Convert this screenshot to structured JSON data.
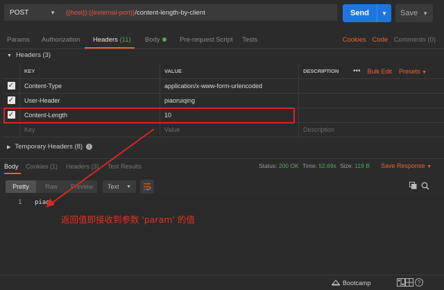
{
  "request": {
    "method": "POST",
    "url_var1": "{{host}}",
    "url_sep": ":",
    "url_var2": "{{external-port}}",
    "url_path": "/content-length-by-client",
    "send_label": "Send",
    "save_label": "Save"
  },
  "tabs": {
    "params": "Params",
    "authorization": "Authorization",
    "headers": "Headers",
    "headers_count": "(11)",
    "body": "Body",
    "prerequest": "Pre-request Script",
    "tests": "Tests",
    "cookies": "Cookies",
    "code": "Code",
    "comments": "Comments (0)"
  },
  "headers_section": {
    "title": "Headers (3)",
    "col_key": "KEY",
    "col_value": "VALUE",
    "col_description": "DESCRIPTION",
    "more": "•••",
    "bulk_edit": "Bulk Edit",
    "presets": "Presets",
    "rows": [
      {
        "key": "Content-Type",
        "value": "application/x-www-form-urlencoded"
      },
      {
        "key": "User-Header",
        "value": "piaoruiqing"
      },
      {
        "key": "Content-Length",
        "value": "10"
      }
    ],
    "placeholder_key": "Key",
    "placeholder_value": "Value",
    "placeholder_description": "Description",
    "temporary": "Temporary Headers (8)"
  },
  "response": {
    "tab_body": "Body",
    "tab_cookies": "Cookies (1)",
    "tab_headers": "Headers (3)",
    "tab_tests": "Test Results",
    "status_label": "Status:",
    "status_value": "200 OK",
    "time_label": "Time:",
    "time_value": "52.69s",
    "size_label": "Size:",
    "size_value": "119 B",
    "save_response": "Save Response",
    "view_pretty": "Pretty",
    "view_raw": "Raw",
    "view_preview": "Preview",
    "format": "Text",
    "line_number": "1",
    "code_line": "piao"
  },
  "annotation": "返回值即接收到参数 'param' 的值",
  "footer": {
    "bootcamp": "Bootcamp",
    "help": "?"
  },
  "colors": {
    "accent": "#e8652f",
    "send": "#1f74e0",
    "ok": "#4caf50",
    "annotation": "#e0341f"
  }
}
